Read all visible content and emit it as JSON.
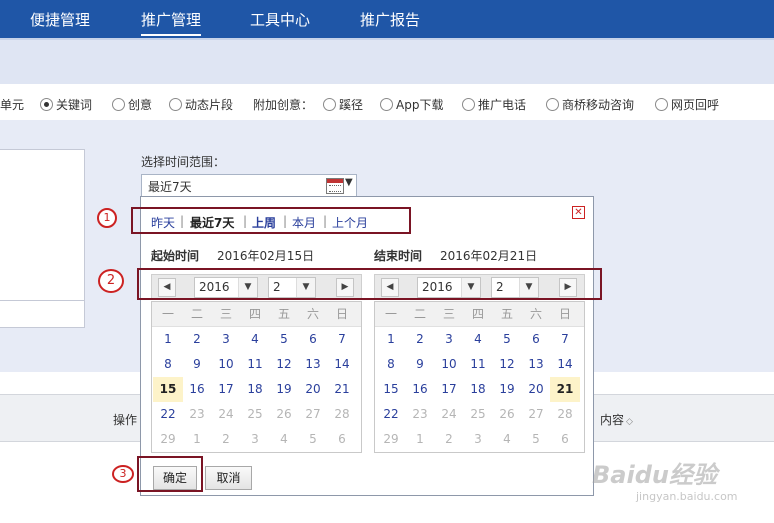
{
  "nav": {
    "items": [
      "便捷管理",
      "推广管理",
      "工具中心",
      "推广报告"
    ]
  },
  "radios": [
    {
      "label": "单元",
      "checked": false,
      "partial": true
    },
    {
      "label": "关键词",
      "checked": true
    },
    {
      "label": "创意",
      "checked": false
    },
    {
      "label": "动态片段",
      "checked": false
    },
    {
      "label": "附加创意：",
      "plain": true
    },
    {
      "label": "蹊径",
      "checked": false
    },
    {
      "label": "App下载",
      "checked": false
    },
    {
      "label": "推广电话",
      "checked": false
    },
    {
      "label": "商桥移动咨询",
      "checked": false
    },
    {
      "label": "网页回呼",
      "checked": false
    }
  ],
  "time_range": {
    "label": "选择时间范围：",
    "value": "最近7天"
  },
  "quick_links": [
    "昨天",
    "最近7天",
    "上周",
    "本月",
    "上个月"
  ],
  "start": {
    "title": "起始时间",
    "date": "2016年02月15日",
    "year": "2016",
    "month": "2"
  },
  "end": {
    "title": "结束时间",
    "date": "2016年02月21日",
    "year": "2016",
    "month": "2"
  },
  "weekdays": [
    "一",
    "二",
    "三",
    "四",
    "五",
    "六",
    "日"
  ],
  "days": [
    [
      "1",
      "2",
      "3",
      "4",
      "5",
      "6",
      "7"
    ],
    [
      "8",
      "9",
      "10",
      "11",
      "12",
      "13",
      "14"
    ],
    [
      "15",
      "16",
      "17",
      "18",
      "19",
      "20",
      "21"
    ],
    [
      "22",
      "23",
      "24",
      "25",
      "26",
      "27",
      "28"
    ],
    [
      "29",
      "1",
      "2",
      "3",
      "4",
      "5",
      "6"
    ]
  ],
  "buttons": {
    "ok": "确定",
    "cancel": "取消"
  },
  "table_headers": {
    "op": "操作",
    "content": "内容"
  },
  "markers": [
    "1",
    "2",
    "3"
  ],
  "watermark": {
    "brand": "Baidu经验",
    "url": "jingyan.baidu.com"
  },
  "colors": {
    "nav": "#1f56a7",
    "marker": "#7a1424",
    "link": "#2a3f9c",
    "selected_day": "#fdf3c9"
  }
}
